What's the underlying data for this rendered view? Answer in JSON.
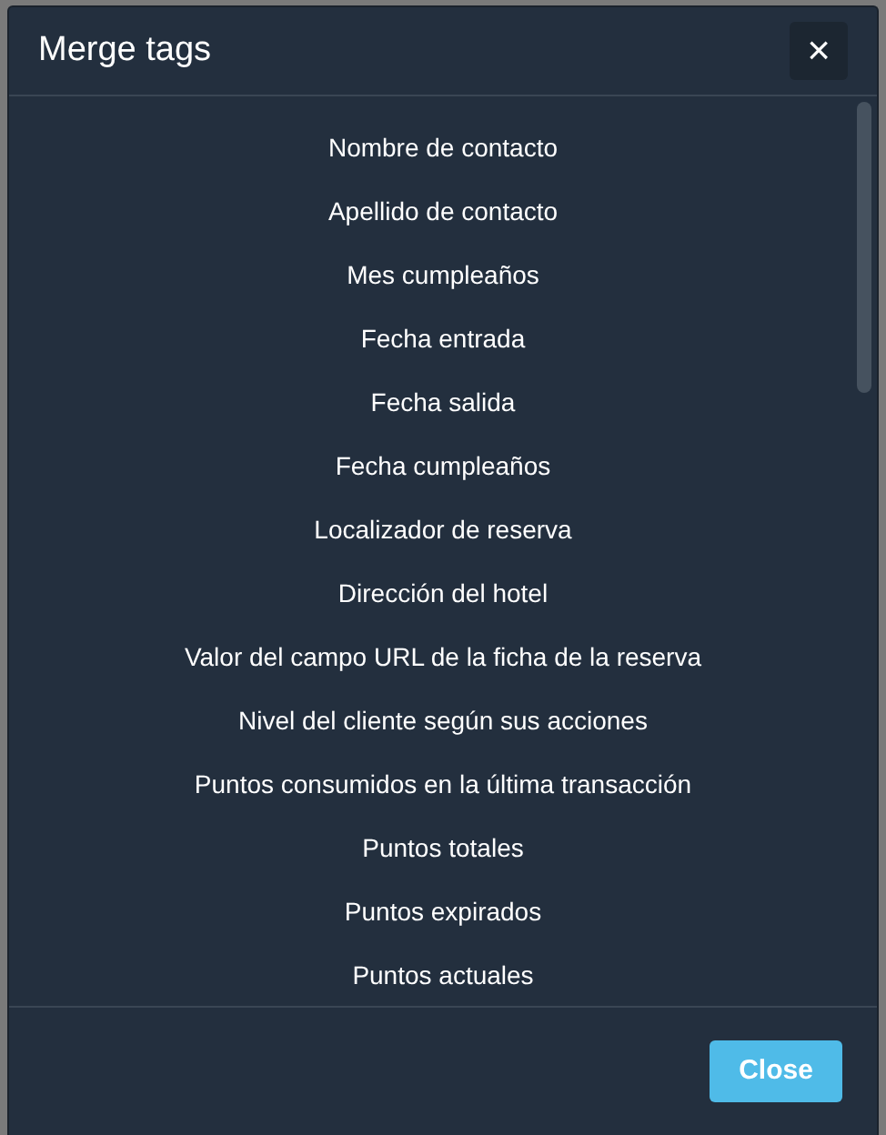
{
  "dialog": {
    "title": "Merge tags",
    "close_icon_button": "×",
    "tags": [
      "Nombre de contacto",
      "Apellido de contacto",
      "Mes cumpleaños",
      "Fecha entrada",
      "Fecha salida",
      "Fecha cumpleaños",
      "Localizador de reserva",
      "Dirección del hotel",
      "Valor del campo URL de la ficha de la reserva",
      "Nivel del cliente según sus acciones",
      "Puntos consumidos en la última transacción",
      "Puntos totales",
      "Puntos expirados",
      "Puntos actuales"
    ],
    "footer_button": "Close"
  }
}
